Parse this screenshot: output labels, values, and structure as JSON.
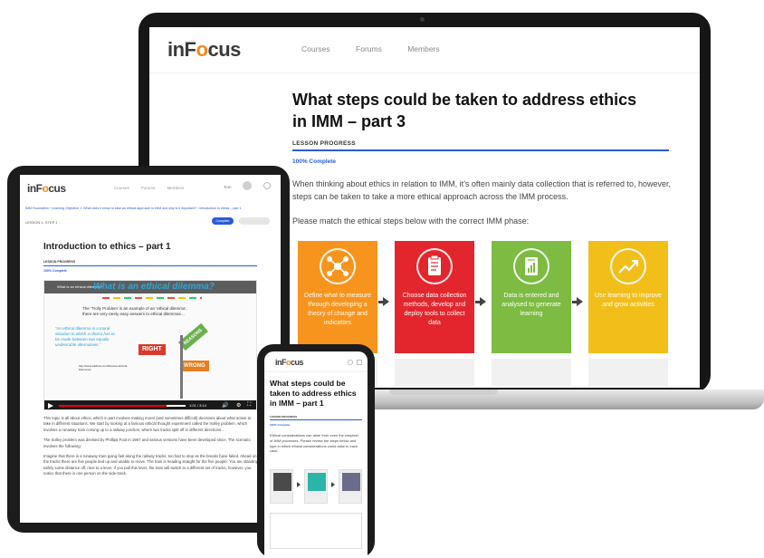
{
  "laptop": {
    "logo": {
      "pre": "inF",
      "o": "o",
      "post": "cus"
    },
    "nav": [
      "Courses",
      "Forums",
      "Members"
    ],
    "title": "What steps could be taken to address ethics in IMM – part 3",
    "progress_label": "LESSON PROGRESS",
    "progress_fraction": 1.0,
    "progress_text": "100% Complete",
    "paragraph": "When thinking about ethics in relation to IMM, it’s often mainly data collection that is referred to, however, steps can be taken to take a more ethical approach across the IMM process.",
    "instruction": "Please match the ethical steps below with the correct IMM phase:",
    "cards": [
      {
        "text": "Define what to measure through developing a theory of change and indicators",
        "color": "#f7941d",
        "icon": "network-icon"
      },
      {
        "text": "Choose data collection methods, develop and deploy tools to collect data",
        "color": "#e3262d",
        "icon": "clipboard-icon"
      },
      {
        "text": "Data is entered and analysed to generate learning",
        "color": "#7dbb42",
        "icon": "document-chart-icon"
      },
      {
        "text": "Use learning to improve and grow activities",
        "color": "#f2be1a",
        "icon": "trend-up-icon"
      }
    ]
  },
  "tablet": {
    "logo": {
      "pre": "inF",
      "o": "o",
      "post": "cus"
    },
    "nav": [
      "Courses",
      "Forums",
      "Members"
    ],
    "user": "Tom",
    "breadcrumb": "IMM Foundation › Learning Objective 1: What does it mean to take an ethical approach to IMM and why is it important? › Introduction to ethics – part 1",
    "step": "LESSON 1, STEP 1",
    "complete_button": "Complete",
    "title": "Introduction to ethics – part 1",
    "progress_label": "LESSON PROGRESS",
    "progress_fraction": 1.0,
    "progress_text": "100% Complete",
    "video": {
      "label": "What is an ethical dilemma?",
      "title": "What is an ethical dilemma?",
      "quote": "The ‘Trolly Problem’ is an example of an ‘ethical dilemma’, there are very rarely easy answers to ethical dilemmas…",
      "definition": "“An ethical dilemma is a moral situation in which a choice has to be made between two equally undesirable alternatives.”",
      "link": "http://www.wikihow.com/Resolve-Ethical-Dilemmas",
      "sign_right": "RIGHT",
      "sign_wrong": "WRONG",
      "sign_reasons": "REASONS",
      "time": "1:01 / 3:14",
      "progress_fraction": 0.85
    },
    "body": [
      "This topic is all about ethics, which in part involves making moral (and sometimes difficult) decisions about what action to take in different situations. We start by looking at a famous ethical thought experiment called the trolley problem, which involves a runaway train coming up to a railway junction, where two tracks split off in different directions…",
      "The trolley problem was devised by Phillipa Foot in 1967 and various versions have been developed since. The scenario involves the following:",
      "Imagine that there is a runaway train going fast along the railway tracks; too fast to stop as the breaks have failed. Ahead on the tracks there are five people tied up and unable to move. The train is heading straight for the five people. You are standing safely some distance off, next to a lever. If you pull this lever, the train will switch to a different set of tracks, however, you notice that there is one person on the side-track."
    ]
  },
  "phone": {
    "logo": {
      "pre": "inF",
      "o": "o",
      "post": "cus"
    },
    "title": "What steps could be taken to address ethics in IMM – part 1",
    "progress_label": "LESSON PROGRESS",
    "progress_fraction": 1.0,
    "progress_text": "100% Complete",
    "paragraph": "Ethical considerations can arise from even the simplest of IMM processes. Please review the steps below and type in which ethical considerations could arise in each case.",
    "cards": [
      {
        "color": "#4a4a4a",
        "icon": "meeting-scene-icon"
      },
      {
        "color": "#2bb5a8",
        "icon": "phone-survey-icon"
      },
      {
        "color": "#6b6b8a",
        "icon": "presentation-scene-icon"
      }
    ]
  }
}
